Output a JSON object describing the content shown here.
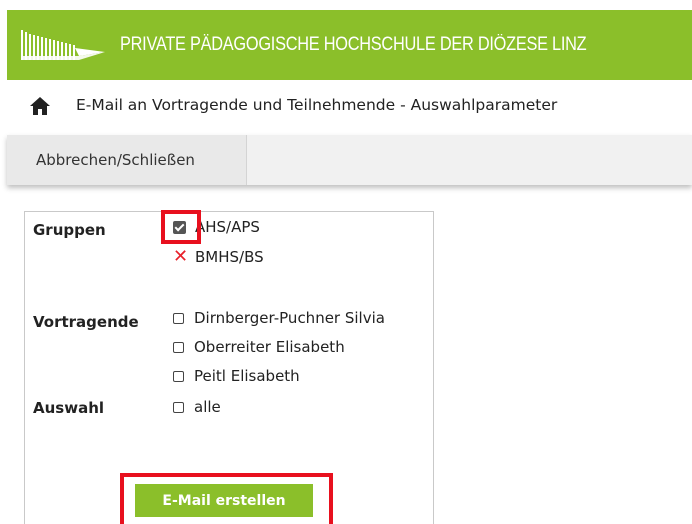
{
  "header": {
    "institution": "PRIVATE PÄDAGOGISCHE HOCHSCHULE DER DIÖZESE LINZ",
    "logo_icon": "ph-linz-logo",
    "brand_color": "#8bbf2a"
  },
  "page": {
    "home_icon": "home-icon",
    "title": "E-Mail an Vortragende und Teilnehmende - Auswahlparameter"
  },
  "toolbar": {
    "cancel_label": "Abbrechen/Schließen"
  },
  "form": {
    "groups_label": "Gruppen",
    "groups": [
      {
        "label": "AHS/APS",
        "state": "checked"
      },
      {
        "label": "BMHS/BS",
        "state": "excluded"
      }
    ],
    "speakers_label": "Vortragende",
    "speakers": [
      {
        "label": "Dirnberger-Puchner Silvia",
        "checked": false
      },
      {
        "label": "Oberreiter Elisabeth",
        "checked": false
      },
      {
        "label": "Peitl Elisabeth",
        "checked": false
      }
    ],
    "selection_label": "Auswahl",
    "selection_all": {
      "label": "alle",
      "checked": false
    },
    "submit_label": "E-Mail erstellen",
    "highlight_color": "#e8101e"
  }
}
